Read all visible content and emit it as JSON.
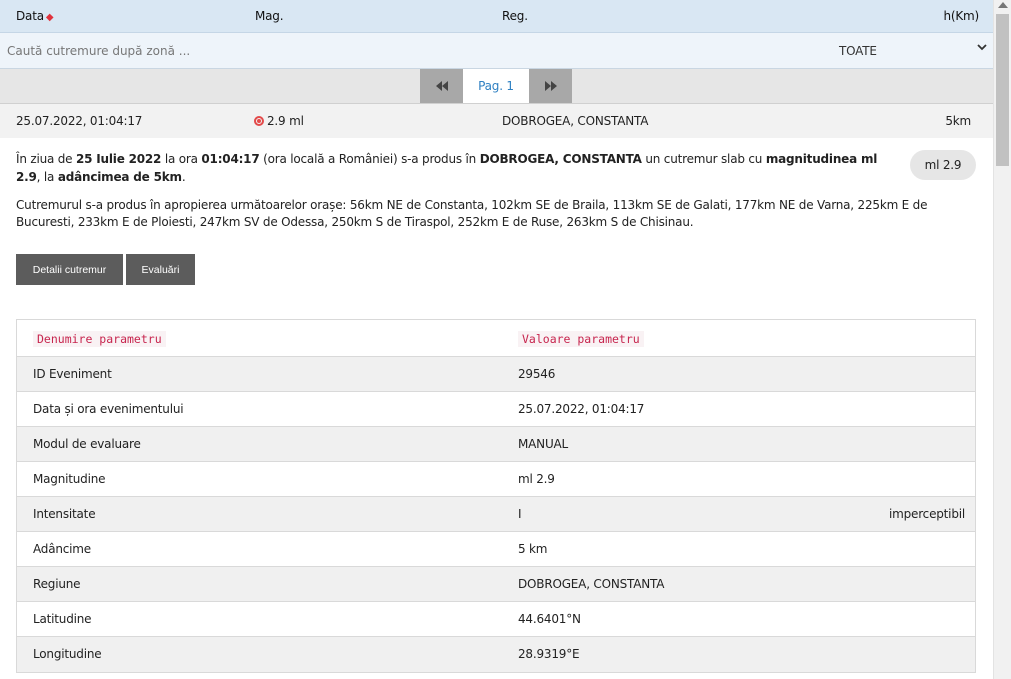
{
  "header": {
    "date_label": "Data",
    "sort_icon": "sort-arrows-icon",
    "mag_label": "Mag.",
    "reg_label": "Reg.",
    "depth_label": "h(Km)"
  },
  "search": {
    "placeholder": "Caută cutremure după zonă ...",
    "filter_value": "TOATE",
    "chevron": "⌄"
  },
  "pager": {
    "prev_icon": "◀◀",
    "page_label": "Pag. 1",
    "next_icon": "▶▶"
  },
  "event": {
    "date": "25.07.2022, 01:04:17",
    "magnitude": "2.9 ml",
    "region": "DOBROGEA, CONSTANTA",
    "depth": "5km",
    "colors": {
      "marker": "#e34a4a"
    }
  },
  "details": {
    "p1_a": "În ziua de ",
    "p1_date": "25 Iulie 2022",
    "p1_b": " la ora ",
    "p1_time": "01:04:17",
    "p1_c": " (ora locală a României) s-a produs în ",
    "p1_region": "DOBROGEA, CONSTANTA",
    "p1_d": " un cutremur slab cu ",
    "p1_mag": "magnitudinea ml 2.9",
    "p1_e": ", la ",
    "p1_depth": "adâncimea de 5km",
    "p1_f": ".",
    "badge": "ml 2.9",
    "p2": "Cutremurul s-a produs în apropierea următoarelor orașe: 56km NE de Constanta, 102km SE de Braila, 113km SE de Galati, 177km NE de Varna, 225km E de Bucuresti, 233km E de Ploiesti, 247km SV de Odessa, 250km S de Tiraspol, 252km E de Ruse, 263km S de Chisinau.",
    "btn_details": "Detalii cutremur",
    "btn_evals": "Evaluări"
  },
  "params": {
    "head_name": "Denumire parametru",
    "head_value": "Valoare parametru",
    "rows": [
      {
        "name": "ID Eveniment",
        "value": "29546",
        "extra": ""
      },
      {
        "name": "Data și ora evenimentului",
        "value": "25.07.2022, 01:04:17",
        "extra": ""
      },
      {
        "name": "Modul de evaluare",
        "value": "MANUAL",
        "extra": ""
      },
      {
        "name": "Magnitudine",
        "value": "ml 2.9",
        "extra": ""
      },
      {
        "name": "Intensitate",
        "value": "I",
        "extra": "imperceptibil"
      },
      {
        "name": "Adâncime",
        "value": "5 km",
        "extra": ""
      },
      {
        "name": "Regiune",
        "value": "DOBROGEA, CONSTANTA",
        "extra": ""
      },
      {
        "name": "Latitudine",
        "value": "44.6401°N",
        "extra": ""
      },
      {
        "name": "Longitudine",
        "value": "28.9319°E",
        "extra": ""
      }
    ]
  }
}
